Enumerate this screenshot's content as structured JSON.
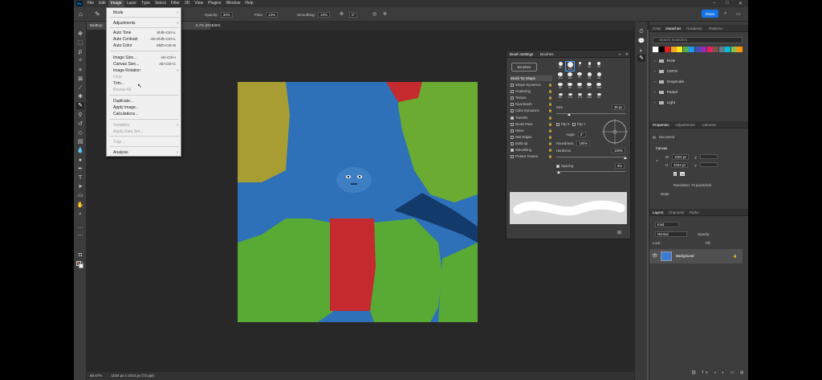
{
  "app": {
    "logo": "Ps"
  },
  "menubar": {
    "items": [
      "File",
      "Edit",
      "Image",
      "Layer",
      "Type",
      "Select",
      "Filter",
      "3D",
      "View",
      "Plugins",
      "Window",
      "Help"
    ],
    "active": "Image"
  },
  "options": {
    "opacity_label": "Opacity:",
    "opacity_value": "30%",
    "flow_label": "Flow:",
    "flow_value": "13%",
    "smoothing_label": "Smoothing:",
    "smoothing_value": "10%",
    "angle_value": "0°",
    "share_label": "Share"
  },
  "document": {
    "tab_title": "BirdExp",
    "tab_suffix": "6.7% (RGB/8#)",
    "zoom": "66.67%",
    "size_info": "1024 px x 1024 px (72 ppi)"
  },
  "image_menu": [
    {
      "label": "Mode",
      "submenu": true
    },
    {
      "label": "Adjustments",
      "submenu": true
    },
    {
      "label": "Auto Tone",
      "shortcut": "Shift+Ctrl+L"
    },
    {
      "label": "Auto Contrast",
      "shortcut": "Alt+Shift+Ctrl+L"
    },
    {
      "label": "Auto Color",
      "shortcut": "Shift+Ctrl+B"
    },
    {
      "label": "Image Size...",
      "shortcut": "Alt+Ctrl+I"
    },
    {
      "label": "Canvas Size...",
      "shortcut": "Alt+Ctrl+C"
    },
    {
      "label": "Image Rotation",
      "submenu": true
    },
    {
      "label": "Crop",
      "disabled": true
    },
    {
      "label": "Trim..."
    },
    {
      "label": "Reveal All",
      "disabled": true
    },
    {
      "label": "Duplicate..."
    },
    {
      "label": "Apply Image..."
    },
    {
      "label": "Calculations..."
    },
    {
      "label": "Variables",
      "submenu": true,
      "disabled": true
    },
    {
      "label": "Apply Data Set...",
      "disabled": true
    },
    {
      "label": "Trap...",
      "disabled": true
    },
    {
      "label": "Analysis",
      "submenu": true
    }
  ],
  "brush_panel": {
    "tabs": [
      "Brush Settings",
      "Brushes"
    ],
    "brushes_button": "Brushes",
    "options": [
      {
        "label": "Brush Tip Shape",
        "head": true
      },
      {
        "label": "Shape Dynamics",
        "checked": false
      },
      {
        "label": "Scattering",
        "checked": false
      },
      {
        "label": "Texture",
        "checked": false
      },
      {
        "label": "Dual Brush",
        "checked": false
      },
      {
        "label": "Color Dynamics",
        "checked": false
      },
      {
        "label": "Transfer",
        "checked": true
      },
      {
        "label": "Brush Pose",
        "checked": false
      },
      {
        "label": "Noise",
        "checked": false
      },
      {
        "label": "Wet Edges",
        "checked": false
      },
      {
        "label": "Build-up",
        "checked": false
      },
      {
        "label": "Smoothing",
        "checked": true
      },
      {
        "label": "Protect Texture",
        "checked": false
      }
    ],
    "tip_sizes": [
      "30",
      "123",
      "8",
      "10",
      "25",
      "112",
      "60",
      "50",
      "25",
      "30",
      "50",
      "60",
      "100",
      "127",
      "284",
      "80",
      "174",
      "175",
      "306",
      "50"
    ],
    "size_label": "Size",
    "size_value": "35 px",
    "flip_x": "Flip X",
    "flip_y": "Flip Y",
    "angle_label": "Angle:",
    "angle_value": "0°",
    "roundness_label": "Roundness:",
    "roundness_value": "100%",
    "hardness_label": "Hardness",
    "hardness_value": "100%",
    "spacing_label": "Spacing",
    "spacing_value": "5%"
  },
  "right_panel": {
    "swatch_tabs": [
      "Color",
      "Swatches",
      "Gradients",
      "Patterns"
    ],
    "search_placeholder": "Search Swatches",
    "swatch_colors": [
      "#ffffff",
      "#000000",
      "#e02020",
      "#f5a623",
      "#f8e71c",
      "#4caf50",
      "#2196f3",
      "#3f51b5",
      "#9c27b0",
      "#e91e63",
      "#795548",
      "#607d8b",
      "#00bcd4",
      "#8bc34a",
      "#ff9800"
    ],
    "folders": [
      "RGB",
      "CMYK",
      "Grayscale",
      "Pastel",
      "Light"
    ],
    "props_tabs": [
      "Properties",
      "Adjustments",
      "Libraries"
    ],
    "doc_label": "Document",
    "canvas_label": "Canvas",
    "w_label": "W",
    "w_value": "1024 px",
    "h_label": "H",
    "h_value": "1024 px",
    "x_label": "X",
    "y_label": "Y",
    "resolution": "Resolution: 72 pixels/inch",
    "mode_label": "Mode",
    "layers_tabs": [
      "Layers",
      "Channels",
      "Paths"
    ],
    "layers_kind": "Kind",
    "layers_blend": "Normal",
    "layers_opacity": "Opacity:",
    "layers_lock": "Lock:",
    "layers_fill": "Fill:",
    "layer_name": "Background"
  }
}
